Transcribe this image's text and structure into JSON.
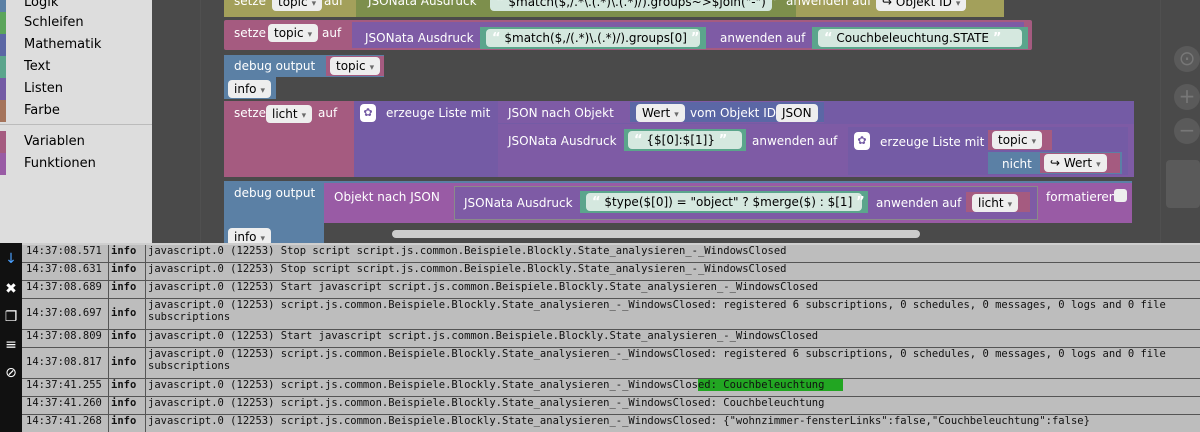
{
  "toolbox": {
    "items": [
      {
        "label": "Logik",
        "color": "#5b80a5"
      },
      {
        "label": "Schleifen",
        "color": "#5ba55b"
      },
      {
        "label": "Mathematik",
        "color": "#5b67a5"
      },
      {
        "label": "Text",
        "color": "#5ba58c"
      },
      {
        "label": "Listen",
        "color": "#745ba5"
      },
      {
        "label": "Farbe",
        "color": "#a5745b"
      },
      {
        "label": "Variablen",
        "color": "#a55b80"
      },
      {
        "label": "Funktionen",
        "color": "#995ba5"
      }
    ]
  },
  "blocks": {
    "b1": {
      "set": "setze",
      "var": "topic",
      "auf": "auf",
      "jsonata": "JSONata Ausdruck",
      "expr": "$match($,/.*\\.(.*)\\.(.*)/).groups~>$join(\"-\")",
      "apply": "anwenden auf",
      "obj": "Objekt ID"
    },
    "b2": {
      "set": "setze",
      "var": "topic",
      "auf": "auf",
      "jsonata": "JSONata Ausdruck",
      "expr": "$match($,/(.*)\\.(.*)/).groups[0]",
      "apply": "anwenden auf",
      "value": "Couchbeleuchtung.STATE"
    },
    "b3": {
      "debug": "debug output",
      "var": "topic",
      "level": "info"
    },
    "b4": {
      "set": "setze",
      "var": "licht",
      "auf": "auf",
      "create_list": "erzeuge Liste mit",
      "json_to_obj": "JSON nach Objekt",
      "wert": "Wert",
      "from_obj": "vom Objekt ID",
      "json": "JSON",
      "jsonata": "JSONata Ausdruck",
      "expr": "{$[0]:$[1]}",
      "apply": "anwenden auf",
      "create_list2": "erzeuge Liste mit",
      "topic": "topic",
      "nicht": "nicht",
      "wert2": "Wert"
    },
    "b5": {
      "debug": "debug output",
      "obj_to_json": "Objekt nach JSON",
      "jsonata": "JSONata Ausdruck",
      "expr": "$type($[0]) = \"object\" ? $merge($) : $[1]",
      "apply": "anwenden auf",
      "var": "licht",
      "format": "formatieren",
      "level": "info"
    }
  },
  "log": {
    "rows": [
      {
        "time": "14:37:08.571",
        "sev": "info",
        "msg": "javascript.0 (12253) Stop script script.js.common.Beispiele.Blockly.State_analysieren_-_WindowsClosed"
      },
      {
        "time": "14:37:08.631",
        "sev": "info",
        "msg": "javascript.0 (12253) Stop script script.js.common.Beispiele.Blockly.State_analysieren_-_WindowsClosed"
      },
      {
        "time": "14:37:08.689",
        "sev": "info",
        "msg": "javascript.0 (12253) Start javascript script.js.common.Beispiele.Blockly.State_analysieren_-_WindowsClosed"
      },
      {
        "time": "14:37:08.697",
        "sev": "info",
        "msg": "javascript.0 (12253) script.js.common.Beispiele.Blockly.State_analysieren_-_WindowsClosed: registered 6 subscriptions, 0 schedules, 0 messages, 0 logs and 0 file subscriptions"
      },
      {
        "time": "14:37:08.809",
        "sev": "info",
        "msg": "javascript.0 (12253) Start javascript script.js.common.Beispiele.Blockly.State_analysieren_-_WindowsClosed"
      },
      {
        "time": "14:37:08.817",
        "sev": "info",
        "msg": "javascript.0 (12253) script.js.common.Beispiele.Blockly.State_analysieren_-_WindowsClosed: registered 6 subscriptions, 0 schedules, 0 messages, 0 logs and 0 file subscriptions"
      },
      {
        "time": "14:37:41.255",
        "sev": "info",
        "msg_pre": "javascript.0 (12253) script.js.common.Beispiele.Blockly.State_analysieren_-_WindowsClos",
        "msg_hl": "ed: Couchbeleuchtung   "
      },
      {
        "time": "14:37:41.260",
        "sev": "info",
        "msg": "javascript.0 (12253) script.js.common.Beispiele.Blockly.State_analysieren_-_WindowsClosed: Couchbeleuchtung"
      },
      {
        "time": "14:37:41.268",
        "sev": "info",
        "msg": "javascript.0 (12253) script.js.common.Beispiele.Blockly.State_analysieren_-_WindowsClosed: {\"wohnzimmer-fensterLinks\":false,\"Couchbeleuchtung\":false}"
      }
    ]
  },
  "icons": {
    "scroll": "↓",
    "clear": "✖",
    "copy": "❐",
    "filter": "≡",
    "hide": "⊘"
  },
  "zoom": {
    "in": "+",
    "out": "−"
  }
}
